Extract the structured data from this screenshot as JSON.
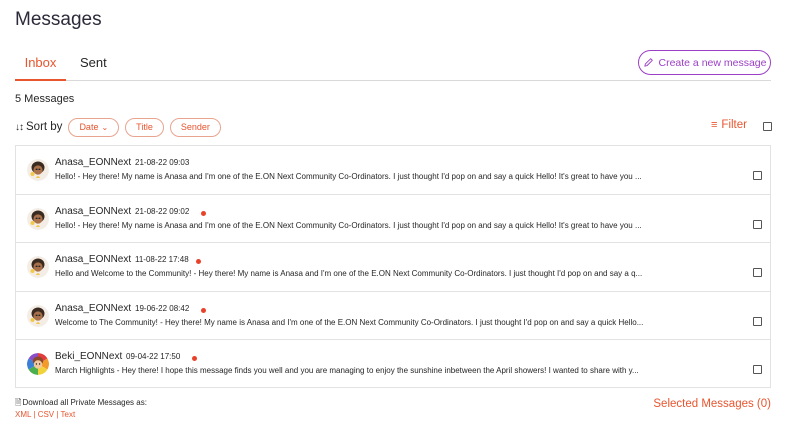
{
  "page": {
    "title": "Messages"
  },
  "tabs": [
    {
      "label": "Inbox",
      "active": true
    },
    {
      "label": "Sent",
      "active": false
    }
  ],
  "create_button": {
    "label": "Create a new message",
    "icon": "pencil-icon"
  },
  "message_count": "5 Messages",
  "sort": {
    "icon": "↓↕",
    "label": "Sort by",
    "options": [
      {
        "label": "Date",
        "dropdown": true
      },
      {
        "label": "Title"
      },
      {
        "label": "Sender"
      }
    ]
  },
  "filter": {
    "label": "Filter",
    "icon": "sliders-icon"
  },
  "messages": [
    {
      "sender": "Anasa_EONNext",
      "time": "21-08-22 09:03",
      "unread": false,
      "avatar": "anasa",
      "preview": "Hello! - Hey there! My name is Anasa and I'm one of the E.ON Next Community Co-Ordinators. I just thought I'd pop on and say a quick Hello! It's great to have you ..."
    },
    {
      "sender": "Anasa_EONNext",
      "time": "21-08-22 09:02",
      "unread": true,
      "avatar": "anasa",
      "preview": "Hello! - Hey there! My name is Anasa and I'm one of the E.ON Next Community Co-Ordinators. I just thought I'd pop on and say a quick Hello! It's great to have you ..."
    },
    {
      "sender": "Anasa_EONNext",
      "time": "11-08-22 17:48",
      "unread": true,
      "avatar": "anasa",
      "preview": "Hello and Welcome to the Community! - Hey there! My name is Anasa and I'm one of the E.ON Next Community Co-Ordinators. I just thought I'd pop on and say a q..."
    },
    {
      "sender": "Anasa_EONNext",
      "time": "19-06-22 08:42",
      "unread": true,
      "avatar": "anasa",
      "preview": "Welcome to The Community! - Hey there! My name is Anasa and I'm one of the E.ON Next Community Co-Ordinators. I just thought I'd pop on and say a quick Hello..."
    },
    {
      "sender": "Beki_EONNext",
      "time": "09-04-22 17:50",
      "unread": true,
      "avatar": "beki",
      "preview": "March Highlights - Hey there! I hope this message finds you well and you are managing to enjoy the sunshine inbetween the April showers! I wanted to share with y..."
    }
  ],
  "download": {
    "label": "Download all Private Messages as:",
    "formats": [
      "XML",
      "CSV",
      "Text"
    ],
    "separator": " | "
  },
  "selected_messages": "Selected Messages (0)",
  "colors": {
    "accent": "#e8552f",
    "create_button": "#9b3fc5",
    "unread_dot": "#e8432a"
  }
}
